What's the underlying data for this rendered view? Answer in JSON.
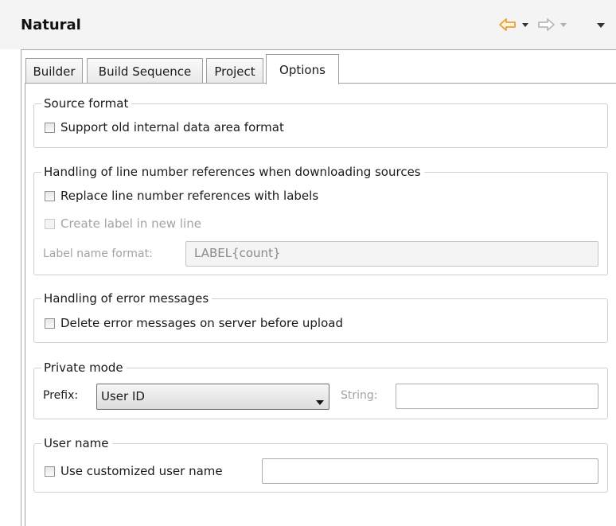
{
  "header": {
    "title": "Natural",
    "icons": [
      "back-arrow-icon",
      "dropdown-arrow-icon",
      "forward-arrow-icon",
      "dropdown-arrow-icon",
      "view-menu-icon"
    ]
  },
  "tabs": [
    {
      "label": "Builder",
      "active": false
    },
    {
      "label": "Build Sequence",
      "active": false
    },
    {
      "label": "Project",
      "active": false
    },
    {
      "label": "Options",
      "active": true
    }
  ],
  "source_format": {
    "legend": "Source format",
    "support_old_ida": {
      "label": "Support old internal data area format",
      "checked": false
    }
  },
  "line_numbers": {
    "legend": "Handling of line number references when downloading sources",
    "replace_refs": {
      "label": "Replace line number references with labels",
      "checked": false
    },
    "create_label_new_line": {
      "label": "Create label in new line",
      "checked": false,
      "enabled": false
    },
    "label_name_format": {
      "label": "Label name format:",
      "value": "LABEL{count}",
      "enabled": false
    }
  },
  "error_messages": {
    "legend": "Handling of error messages",
    "delete_before_upload": {
      "label": "Delete error messages on server before upload",
      "checked": false
    }
  },
  "private_mode": {
    "legend": "Private mode",
    "prefix_label": "Prefix:",
    "prefix_value": "User ID",
    "string_label": "String:",
    "string_value": ""
  },
  "user_name": {
    "legend": "User name",
    "use_custom": {
      "label": "Use customized user name",
      "checked": false
    },
    "value": ""
  },
  "colors": {
    "back_arrow": "#e8a13a",
    "forward_arrow": "#b8b8b8",
    "view_menu": "#333333"
  }
}
